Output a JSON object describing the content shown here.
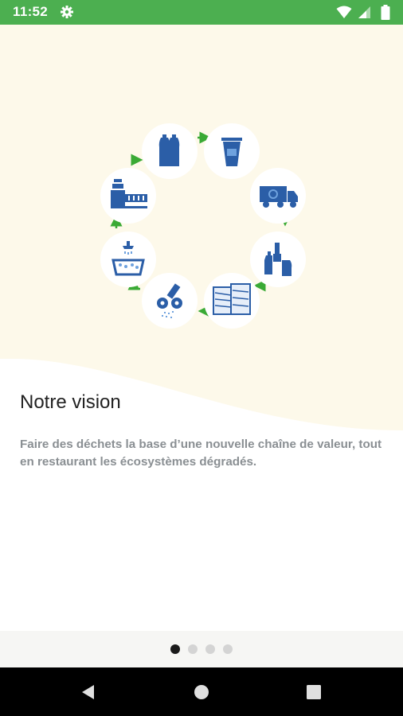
{
  "status_bar": {
    "time": "11:52",
    "icons": [
      "gear-icon",
      "wifi-icon",
      "signal-icon",
      "battery-icon"
    ],
    "color": "#4caf50"
  },
  "onboarding": {
    "illustration": {
      "steps": [
        "bottles-icon",
        "cup-icon",
        "truck-icon",
        "plastic-containers-icon",
        "bales-icon",
        "shredder-icon",
        "washing-icon",
        "extruder-icon"
      ],
      "arrow_color": "#3aaa35",
      "icon_color": "#2b5ea7"
    },
    "title": "Notre vision",
    "description": "Faire des déchets la base d’une nouvelle chaîne de valeur, tout en restaurant les écosystèmes dégradés.",
    "pager": {
      "pages": 4,
      "current": 1
    }
  },
  "nav_bar": {
    "icons": [
      "back-icon",
      "home-icon",
      "recents-icon"
    ]
  }
}
